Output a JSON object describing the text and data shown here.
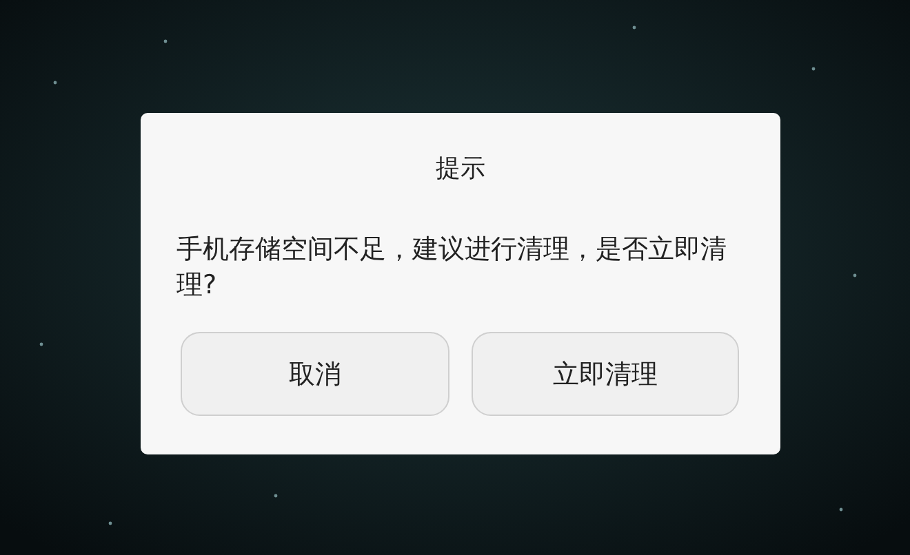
{
  "dialog": {
    "title": "提示",
    "message": "手机存储空间不足，建议进行清理，是否立即清理?",
    "buttons": [
      "取消",
      "立即清理"
    ]
  }
}
